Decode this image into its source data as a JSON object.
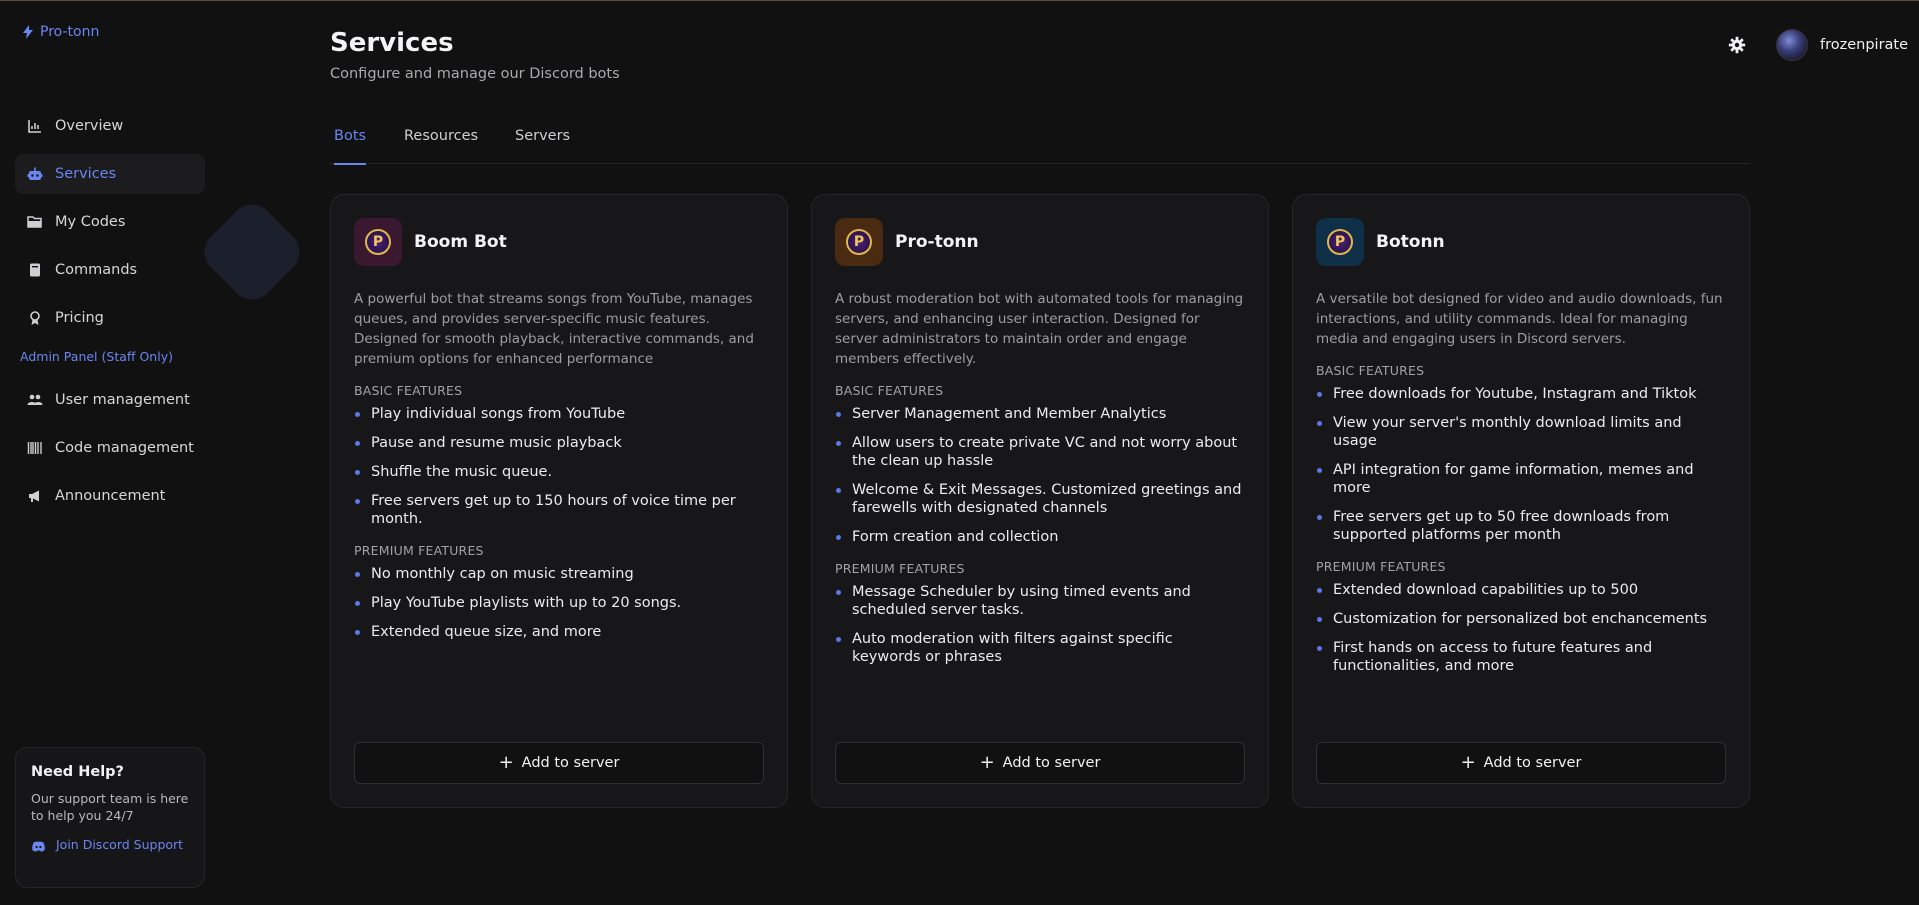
{
  "brand": {
    "name": "Pro-tonn",
    "accent": "#6a86f0"
  },
  "sidebar": {
    "items": [
      {
        "label": "Overview",
        "icon": "chart-icon",
        "active": false
      },
      {
        "label": "Services",
        "icon": "robot-icon",
        "active": true
      },
      {
        "label": "My Codes",
        "icon": "folder-icon",
        "active": false
      },
      {
        "label": "Commands",
        "icon": "book-icon",
        "active": false
      },
      {
        "label": "Pricing",
        "icon": "tag-icon",
        "active": false
      }
    ],
    "admin_label": "Admin Panel (Staff Only)",
    "admin_items": [
      {
        "label": "User management",
        "icon": "users-icon"
      },
      {
        "label": "Code management",
        "icon": "barcode-icon"
      },
      {
        "label": "Announcement",
        "icon": "megaphone-icon"
      }
    ],
    "help": {
      "title": "Need Help?",
      "text": "Our support team is here to help you 24/7",
      "link": "Join Discord Support"
    }
  },
  "header": {
    "title": "Services",
    "subtitle": "Configure and manage our Discord bots",
    "username": "frozenpirate"
  },
  "tabs": [
    {
      "label": "Bots",
      "active": true
    },
    {
      "label": "Resources",
      "active": false
    },
    {
      "label": "Servers",
      "active": false
    }
  ],
  "cards": [
    {
      "name": "Boom Bot",
      "logo_bg": "#3a1830",
      "description": "A powerful bot that streams songs from YouTube, manages queues, and provides server-specific music features. Designed for smooth playback, interactive commands, and premium options for enhanced performance",
      "basic_title": "BASIC FEATURES",
      "basic": [
        "Play individual songs from YouTube",
        "Pause and resume music playback",
        "Shuffle the music queue.",
        "Free servers get up to 150 hours of voice time per month."
      ],
      "premium_title": "PREMIUM FEATURES",
      "premium": [
        "No monthly cap on music streaming",
        "Play YouTube playlists with up to 20 songs.",
        "Extended queue size, and more"
      ],
      "button": "Add to server"
    },
    {
      "name": "Pro-tonn",
      "logo_bg": "#4a2a10",
      "description": "A robust moderation bot with automated tools for managing servers, and enhancing user interaction. Designed for server administrators to maintain order and engage members effectively.",
      "basic_title": "BASIC FEATURES",
      "basic": [
        "Server Management and Member Analytics",
        "Allow users to create private VC and not worry about the clean up hassle",
        "Welcome & Exit Messages. Customized greetings and farewells with designated channels",
        "Form creation and collection"
      ],
      "premium_title": "PREMIUM FEATURES",
      "premium": [
        "Message Scheduler by using timed events and scheduled server tasks.",
        "Auto moderation with filters against specific keywords or phrases"
      ],
      "button": "Add to server"
    },
    {
      "name": "Botonn",
      "logo_bg": "#10304a",
      "description": "A versatile bot designed for video and audio downloads, fun interactions, and utility commands. Ideal for managing media and engaging users in Discord servers.",
      "basic_title": "BASIC FEATURES",
      "basic": [
        "Free downloads for Youtube, Instagram and Tiktok",
        "View your server's monthly download limits and usage",
        "API integration for game information, memes and more",
        "Free servers get up to 50 free downloads from supported platforms per month"
      ],
      "premium_title": "PREMIUM FEATURES",
      "premium": [
        "Extended download capabilities up to 500",
        "Customization for personalized bot enchancements",
        "First hands on access to future features and functionalities, and more"
      ],
      "button": "Add to server"
    }
  ]
}
